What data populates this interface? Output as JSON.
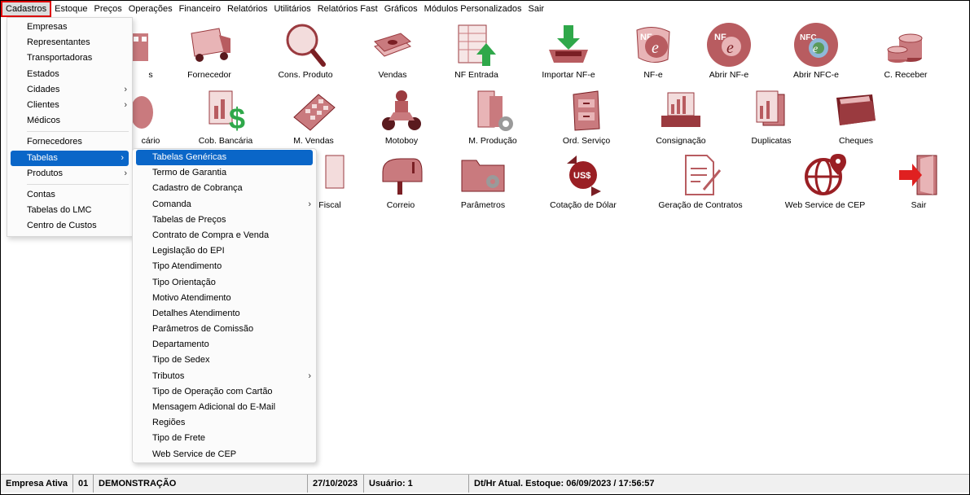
{
  "menubar": [
    "Cadastros",
    "Estoque",
    "Preços",
    "Operações",
    "Financeiro",
    "Relatórios",
    "Utilitários",
    "Relatórios Fast",
    "Gráficos",
    "Módulos Personalizados",
    "Sair"
  ],
  "desktop": {
    "row1": [
      "s",
      "Fornecedor",
      "Cons. Produto",
      "Vendas",
      "NF Entrada",
      "Importar NF-e",
      "NF-e",
      "Abrir NF-e",
      "Abrir NFC-e",
      "C. Receber"
    ],
    "row2": [
      "cário",
      "Cob. Bancária",
      "M. Vendas",
      "Motoboy",
      "M. Produção",
      "Ord. Serviço",
      "Consignação",
      "Duplicatas",
      "Cheques"
    ],
    "row3": [
      "Fiscal",
      "Correio",
      "Parâmetros",
      "Cotação de Dólar",
      "Geração de Contratos",
      "Web Service de CEP",
      "Sair"
    ],
    "icon_text": {
      "nfe": "NF",
      "nfce": "NFC",
      "dollar": "US$"
    }
  },
  "cadastros_menu": {
    "items": [
      "Empresas",
      "Representantes",
      "Transportadoras",
      "Estados",
      "Cidades",
      "Clientes",
      "Médicos",
      "Fornecedores",
      "Tabelas",
      "Produtos",
      "Contas",
      "Tabelas do LMC",
      "Centro de Custos"
    ],
    "submenu_arrow": "›"
  },
  "tabelas_menu": {
    "items": [
      "Tabelas Genéricas",
      "Termo de Garantia",
      "Cadastro de Cobrança",
      "Comanda",
      "Tabelas de Preços",
      "Contrato de Compra e Venda",
      "Legislação do EPI",
      "Tipo Atendimento",
      "Tipo Orientação",
      "Motivo Atendimento",
      "Detalhes Atendimento",
      "Parâmetros de Comissão",
      "Departamento",
      "Tipo de Sedex",
      "Tributos",
      "Tipo de Operação com Cartão",
      "Mensagem Adicional do E-Mail",
      "Regiões",
      "Tipo de Frete",
      "Web Service de CEP"
    ]
  },
  "status": {
    "label": "Empresa Ativa",
    "code": "01",
    "company": "DEMONSTRAÇÃO",
    "date": "27/10/2023",
    "user": "Usuário: 1",
    "stock": "Dt/Hr Atual. Estoque: 06/09/2023 / 17:56:57"
  },
  "colors": {
    "icon": "#b85c60",
    "icon_dark": "#7a1f24",
    "icon_light": "#e9b9bb",
    "selection": "#0a66c8",
    "highlight_border": "#e00000"
  }
}
